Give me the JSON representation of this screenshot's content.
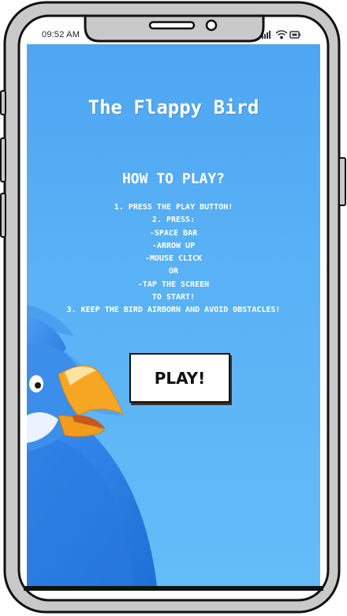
{
  "status_bar": {
    "time": "09:52 AM",
    "icons": [
      "signal-icon",
      "wifi-icon",
      "battery-icon"
    ]
  },
  "app": {
    "title": "The Flappy Bird",
    "how_to_heading": "HOW TO PLAY?",
    "instructions": [
      "1. PRESS THE PLAY BUTTON!",
      "2. PRESS:",
      "-SPACE BAR",
      "-ARROW UP",
      "-MOUSE CLICK",
      "OR",
      "-TAP THE SCREEN",
      "TO START!",
      "3. KEEP THE BIRD AIRBORN AND AVOID OBSTACLES!"
    ],
    "play_label": "PLAY!"
  },
  "colors": {
    "background_top": "#4ea6f3",
    "background_bottom": "#64bcf8",
    "bird_body": "#2f80e6",
    "bird_beak": "#f5a623"
  }
}
